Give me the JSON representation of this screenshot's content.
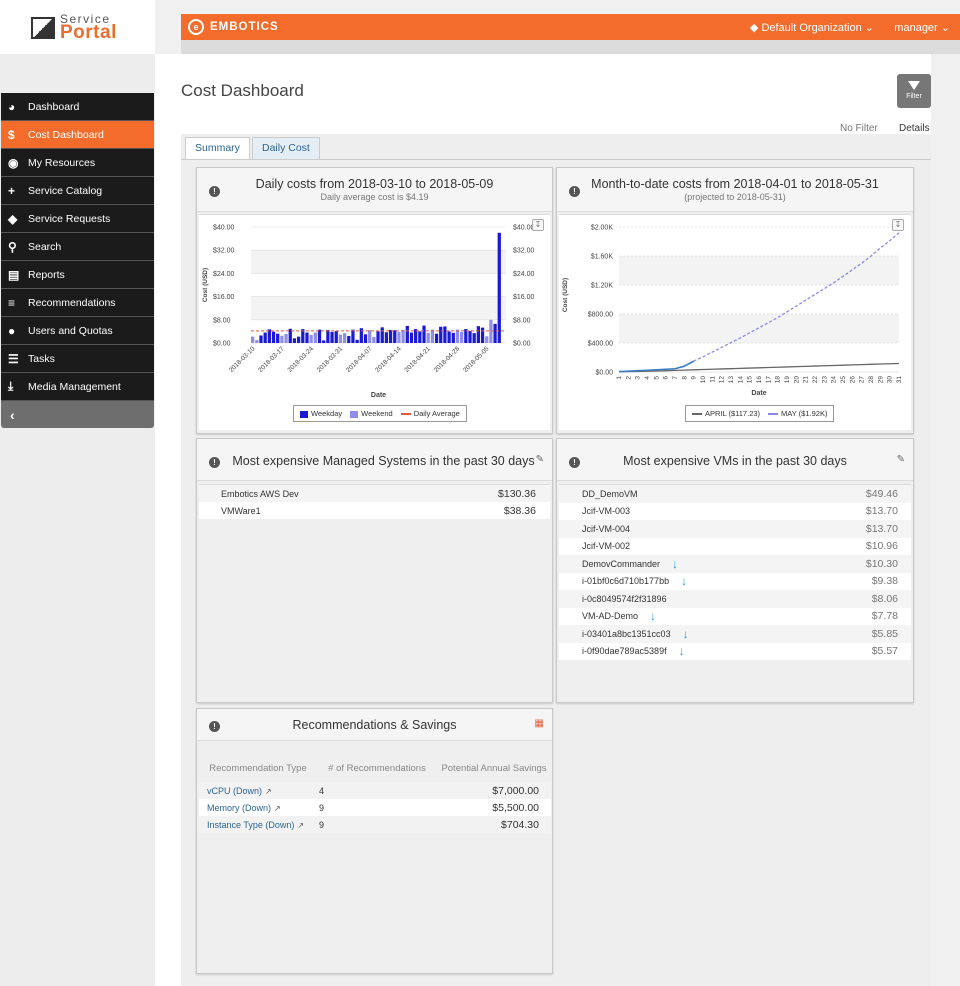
{
  "logo": {
    "line1": "Service",
    "line2": "Portal"
  },
  "topbar": {
    "brand": "EMBOTICS",
    "organization": "Default Organization",
    "user": "manager"
  },
  "sidebar": {
    "items": [
      {
        "label": "Dashboard",
        "icon": "dashboard-icon"
      },
      {
        "label": "Cost Dashboard",
        "icon": "dollar-icon"
      },
      {
        "label": "My Resources",
        "icon": "resources-icon"
      },
      {
        "label": "Service Catalog",
        "icon": "plus-icon"
      },
      {
        "label": "Service Requests",
        "icon": "tags-icon"
      },
      {
        "label": "Search",
        "icon": "search-icon"
      },
      {
        "label": "Reports",
        "icon": "reports-icon"
      },
      {
        "label": "Recommendations",
        "icon": "sliders-icon"
      },
      {
        "label": "Users and Quotas",
        "icon": "users-icon"
      },
      {
        "label": "Tasks",
        "icon": "tasks-icon"
      },
      {
        "label": "Media Management",
        "icon": "download-icon"
      }
    ],
    "active": "Cost Dashboard",
    "collapse_icon": "chevron-left-icon"
  },
  "page": {
    "title": "Cost Dashboard",
    "filter_label": "Filter",
    "filter_status": "No Filter",
    "details_label": "Details",
    "tabs": [
      "Summary",
      "Daily Cost"
    ],
    "active_tab": "Summary"
  },
  "daily_panel": {
    "title": "Daily costs from 2018-03-10 to 2018-05-09",
    "subtitle": "Daily average cost is $4.19",
    "legend": [
      "Weekday",
      "Weekend",
      "Daily Average"
    ]
  },
  "mtd_panel": {
    "title": "Month-to-date costs from 2018-04-01 to 2018-05-31",
    "subtitle": "(projected to 2018-05-31)",
    "legend": [
      "APRIL ($117.23)",
      "MAY ($1.92K)"
    ]
  },
  "systems_panel": {
    "title": "Most expensive Managed Systems in the past 30 days",
    "rows": [
      {
        "name": "Embotics AWS Dev",
        "value": "$130.36"
      },
      {
        "name": "VMWare1",
        "value": "$38.36"
      }
    ]
  },
  "vms_panel": {
    "title": "Most expensive VMs in the past 30 days",
    "rows": [
      {
        "name": "DD_DemoVM",
        "value": "$49.46",
        "arrow": false
      },
      {
        "name": "Jcif-VM-003",
        "value": "$13.70",
        "arrow": false
      },
      {
        "name": "Jcif-VM-004",
        "value": "$13.70",
        "arrow": false
      },
      {
        "name": "Jcif-VM-002",
        "value": "$10.96",
        "arrow": false
      },
      {
        "name": "DemovCommander",
        "value": "$10.30",
        "arrow": true
      },
      {
        "name": "i-01bf0c6d710b177bb",
        "value": "$9.38",
        "arrow": true
      },
      {
        "name": "i-0c8049574f2f31896",
        "value": "$8.06",
        "arrow": false
      },
      {
        "name": "VM-AD-Demo",
        "value": "$7.78",
        "arrow": true
      },
      {
        "name": "i-03401a8bc1351cc03",
        "value": "$5.85",
        "arrow": true
      },
      {
        "name": "i-0f90dae789ac5389f",
        "value": "$5.57",
        "arrow": true
      }
    ]
  },
  "recommendations_panel": {
    "title": "Recommendations & Savings",
    "headers": [
      "Recommendation Type",
      "# of Recommendations",
      "Potential Annual Savings"
    ],
    "rows": [
      {
        "type": "vCPU (Down)",
        "count": "4",
        "savings": "$7,000.00"
      },
      {
        "type": "Memory (Down)",
        "count": "9",
        "savings": "$5,500.00"
      },
      {
        "type": "Instance Type (Down)",
        "count": "9",
        "savings": "$704.30"
      }
    ]
  },
  "colors": {
    "accent": "#f36c2b",
    "weekday": "#1a1ad6",
    "weekend": "#8f8fea",
    "average": "#e05a3a",
    "april": "#666666",
    "may": "#3a7cc6"
  },
  "chart_data": [
    {
      "type": "bar",
      "title": "Daily costs from 2018-03-10 to 2018-05-09",
      "subtitle": "Daily average cost is $4.19",
      "xlabel": "Date",
      "ylabel": "Cost (USD)",
      "ylim": [
        0,
        40
      ],
      "yticks": [
        "$0.00",
        "$8.00",
        "$16.00",
        "$24.00",
        "$32.00",
        "$40.00"
      ],
      "xticks": [
        "2018-03-10",
        "2018-03-17",
        "2018-03-24",
        "2018-03-31",
        "2018-04-07",
        "2018-04-14",
        "2018-04-21",
        "2018-04-28",
        "2018-05-05"
      ],
      "average": 4.19,
      "legend": "bottom-center",
      "grid": true,
      "series": [
        {
          "name": "Weekday",
          "values": [
            0,
            0,
            2.6,
            3.6,
            4.7,
            3.9,
            3.2,
            0,
            0,
            4.9,
            1.6,
            2.2,
            4.8,
            3.6,
            0,
            0,
            4.6,
            0.9,
            4.5,
            3.8,
            4.1,
            0,
            0,
            2.4,
            4.6,
            1.1,
            5.1,
            3.0,
            0,
            0,
            4.0,
            5.4,
            3.7,
            4.5,
            4.4,
            0,
            0,
            5.9,
            3.6,
            4.8,
            4.0,
            6.0,
            0,
            0,
            3.2,
            5.6,
            5.7,
            4.0,
            3.5,
            0,
            0,
            4.8,
            4.1,
            3.4,
            5.8,
            5.3,
            0,
            0,
            6.6,
            38.0,
            0
          ]
        },
        {
          "name": "Weekend",
          "values": [
            2.2,
            1.0,
            0,
            0,
            0,
            0,
            0,
            2.5,
            3.1,
            0,
            0,
            0,
            0,
            0,
            2.8,
            3.6,
            0,
            0,
            0,
            0,
            0,
            2.9,
            3.4,
            0,
            0,
            0,
            0,
            0,
            4.4,
            2.1,
            0,
            0,
            0,
            0,
            0,
            3.8,
            4.5,
            0,
            0,
            0,
            0,
            0,
            3.5,
            4.6,
            0,
            0,
            0,
            0,
            0,
            4.6,
            3.8,
            0,
            0,
            0,
            0,
            0,
            2.3,
            8.0,
            0,
            0,
            0
          ]
        }
      ]
    },
    {
      "type": "line",
      "title": "Month-to-date costs from 2018-04-01 to 2018-05-31",
      "subtitle": "(projected to 2018-05-31)",
      "xlabel": "Date",
      "ylabel": "Cost (USD)",
      "ylim": [
        0,
        2000
      ],
      "yticks": [
        "$0.00",
        "$400.00",
        "$800.00",
        "$1.20K",
        "$1.60K",
        "$2.00K"
      ],
      "x": [
        1,
        2,
        3,
        4,
        5,
        6,
        7,
        8,
        9,
        10,
        11,
        12,
        13,
        14,
        15,
        16,
        17,
        18,
        19,
        20,
        21,
        22,
        23,
        24,
        25,
        26,
        27,
        28,
        29,
        30,
        31
      ],
      "legend": "bottom-center",
      "grid": true,
      "series": [
        {
          "name": "APRIL ($117.23)",
          "style": "solid",
          "values": [
            3,
            6,
            8,
            10,
            14,
            18,
            22,
            26,
            30,
            34,
            38,
            42,
            46,
            50,
            54,
            58,
            62,
            66,
            70,
            74,
            78,
            82,
            86,
            90,
            94,
            98,
            102,
            106,
            110,
            114,
            117.23
          ]
        },
        {
          "name": "MAY ($1.92K)",
          "style": "solid+projected",
          "values": [
            6,
            12,
            18,
            24,
            31,
            38,
            45,
            80,
            150,
            210,
            275,
            340,
            405,
            470,
            540,
            610,
            680,
            750,
            830,
            910,
            990,
            1070,
            1150,
            1230,
            1320,
            1410,
            1500,
            1600,
            1710,
            1810,
            1920
          ]
        }
      ]
    }
  ]
}
